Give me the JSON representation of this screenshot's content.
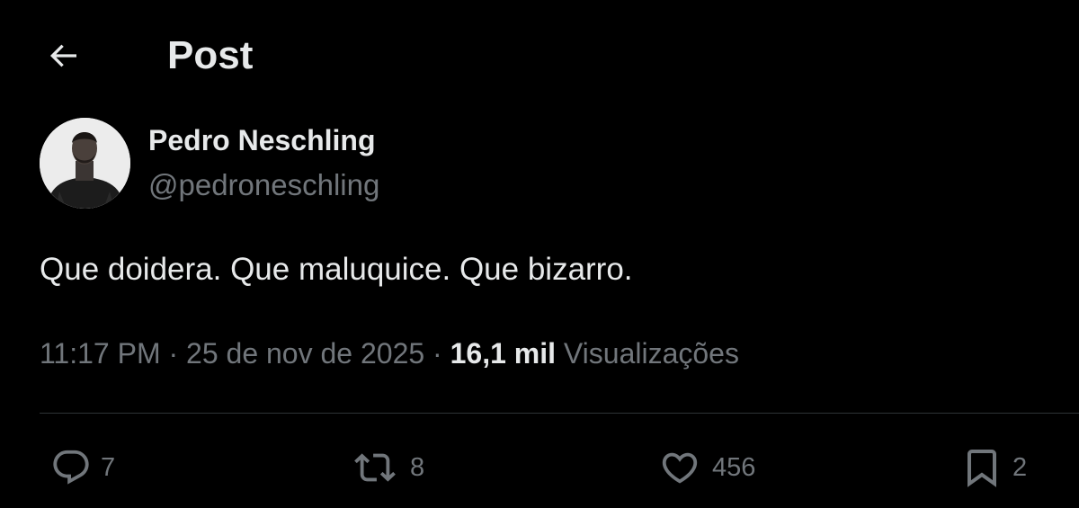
{
  "header": {
    "back_icon": "arrow-left-icon",
    "title": "Post"
  },
  "author": {
    "display_name": "Pedro Neschling",
    "handle": "@pedroneschling",
    "avatar_icon": "profile-photo"
  },
  "post": {
    "text": "Que doidera. Que maluquice. Que bizarro.",
    "time": "11:17 PM",
    "separator": "·",
    "date": "25 de nov de 2025",
    "views_count": "16,1 mil",
    "views_label": "Visualizações"
  },
  "actions": {
    "reply": {
      "icon": "reply-icon",
      "count": "7"
    },
    "repost": {
      "icon": "repost-icon",
      "count": "8"
    },
    "like": {
      "icon": "heart-icon",
      "count": "456"
    },
    "bookmark": {
      "icon": "bookmark-icon",
      "count": "2"
    }
  },
  "colors": {
    "background": "#000000",
    "primary_text": "#e7e9ea",
    "secondary_text": "#71767b",
    "divider": "#2f3336"
  }
}
